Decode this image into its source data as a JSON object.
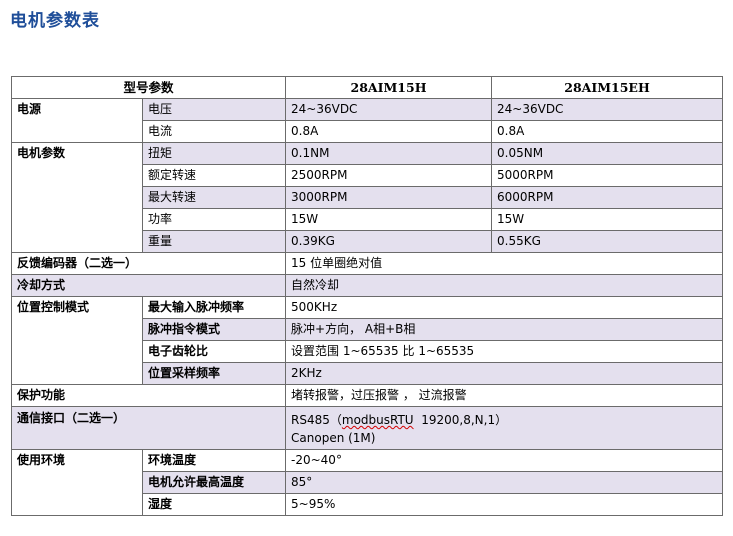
{
  "page": {
    "title": "电机参数表"
  },
  "table": {
    "header": {
      "param": "型号参数",
      "model_a": "28AIM15H",
      "model_b": "28AIM15EH"
    },
    "power": {
      "label": "电源",
      "voltage": {
        "label": "电压",
        "a": "24~36VDC",
        "b": "24~36VDC"
      },
      "current": {
        "label": "电流",
        "a": "0.8A",
        "b": "0.8A"
      }
    },
    "motor": {
      "label": "电机参数",
      "torque": {
        "label": "扭矩",
        "a": "0.1NM",
        "b": "0.05NM"
      },
      "rated_speed": {
        "label": "额定转速",
        "a": "2500RPM",
        "b": "5000RPM"
      },
      "max_speed": {
        "label": "最大转速",
        "a": "3000RPM",
        "b": "6000RPM"
      },
      "power": {
        "label": "功率",
        "a": "15W",
        "b": "15W"
      },
      "weight": {
        "label": "重量",
        "a": "0.39KG",
        "b": "0.55KG"
      }
    },
    "encoder": {
      "label": "反馈编码器（二选一）",
      "value": "15 位单圈绝对值"
    },
    "cooling": {
      "label": "冷却方式",
      "value": "自然冷却"
    },
    "position": {
      "label": "位置控制模式",
      "max_pulse": {
        "label": "最大输入脉冲频率",
        "value": "500KHz"
      },
      "pulse_mode": {
        "label": "脉冲指令模式",
        "value": "脉冲+方向， A相+B相"
      },
      "gear": {
        "label": "电子齿轮比",
        "value": "设置范围 1~65535 比 1~65535"
      },
      "sampling": {
        "label": "位置采样频率",
        "value": "2KHz"
      }
    },
    "protection": {
      "label": "保护功能",
      "value": "堵转报警，过压报警 ， 过流报警"
    },
    "comm": {
      "label": "通信接口（二选一）",
      "line1_prefix": "RS485（",
      "line1_proto": "modbusRTU",
      "line1_suffix": "  19200,8,N,1）",
      "line2": "Canopen (1M)"
    },
    "environment": {
      "label": "使用环境",
      "ambient_temp": {
        "label": "环境温度",
        "value": "-20~40°"
      },
      "max_motor_temp": {
        "label": "电机允许最高温度",
        "value": "85°"
      },
      "humidity": {
        "label": "湿度",
        "value": "5~95%"
      }
    }
  }
}
